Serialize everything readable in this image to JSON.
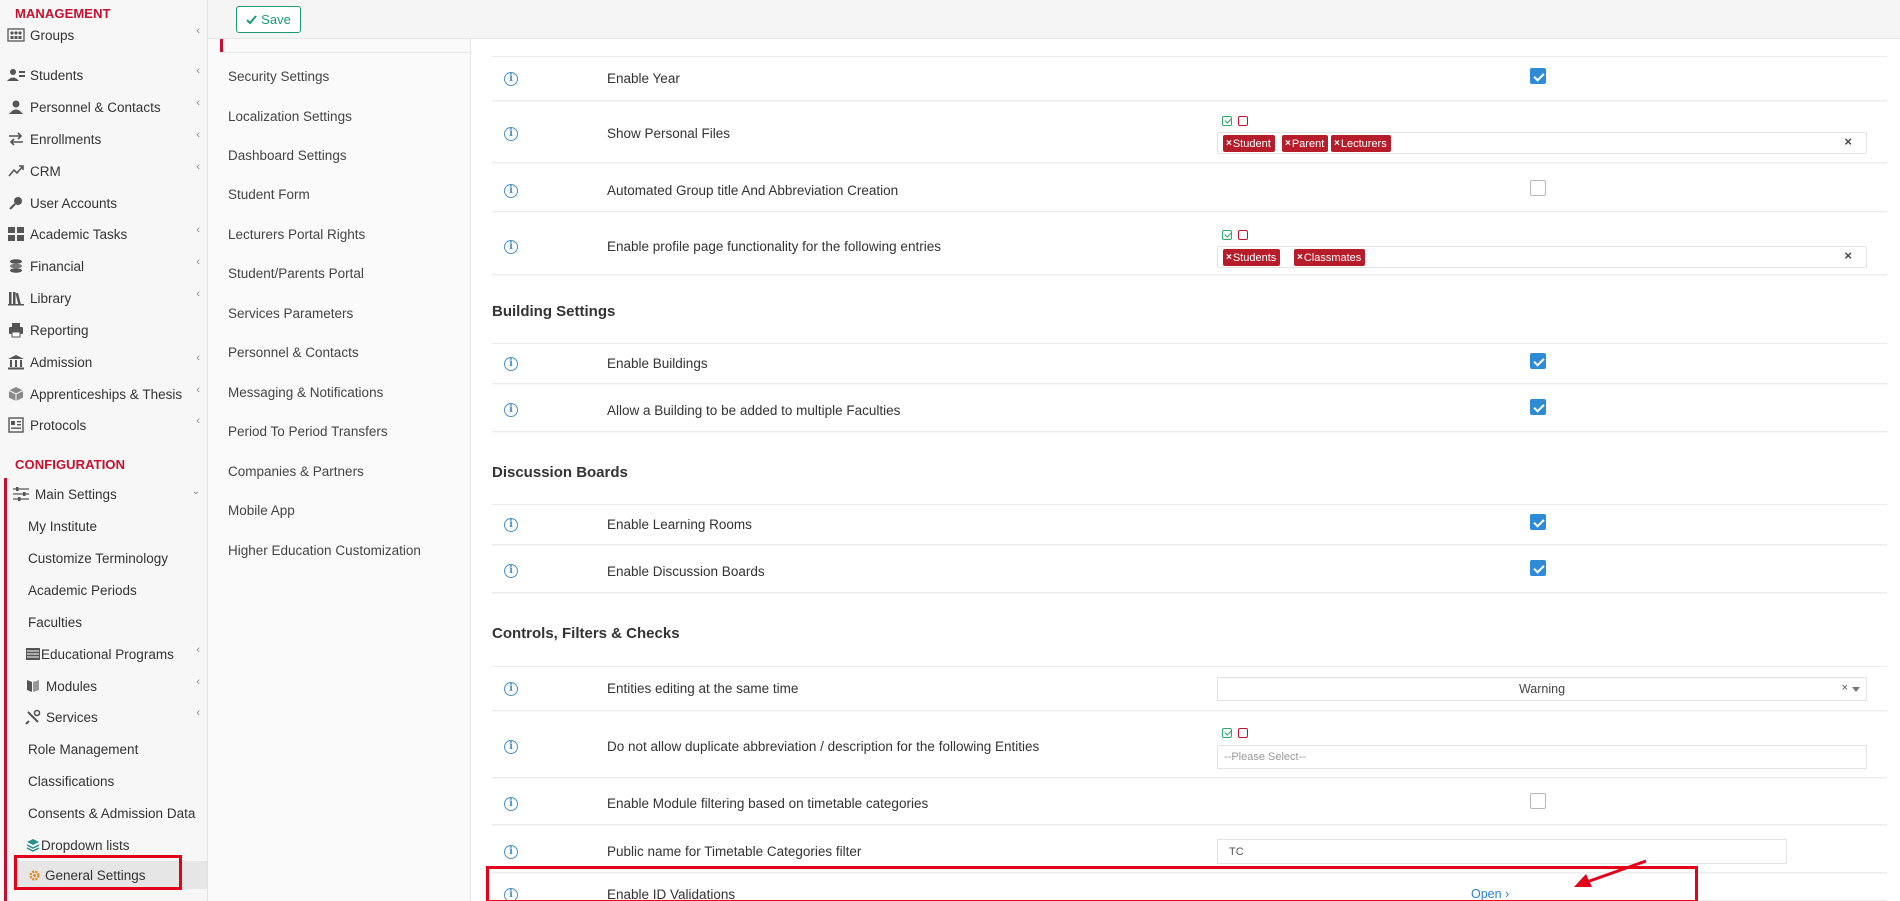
{
  "sidebar": {
    "management_title": "MANAGEMENT",
    "configuration_title": "CONFIGURATION",
    "management_items": [
      {
        "label": "Groups",
        "icon": "groups-icon",
        "has_submenu": true
      },
      {
        "label": "Students",
        "icon": "students-icon",
        "has_submenu": true
      },
      {
        "label": "Personnel & Contacts",
        "icon": "personnel-icon",
        "has_submenu": true
      },
      {
        "label": "Enrollments",
        "icon": "enrollments-icon",
        "has_submenu": true
      },
      {
        "label": "CRM",
        "icon": "crm-icon",
        "has_submenu": true
      },
      {
        "label": "User Accounts",
        "icon": "key-icon",
        "has_submenu": false
      },
      {
        "label": "Academic Tasks",
        "icon": "grid-icon",
        "has_submenu": true
      },
      {
        "label": "Financial",
        "icon": "coins-icon",
        "has_submenu": true
      },
      {
        "label": "Library",
        "icon": "library-icon",
        "has_submenu": true
      },
      {
        "label": "Reporting",
        "icon": "print-icon",
        "has_submenu": false
      },
      {
        "label": "Admission",
        "icon": "institution-icon",
        "has_submenu": true
      },
      {
        "label": "Apprenticeships & Thesis",
        "icon": "cube-icon",
        "has_submenu": true
      },
      {
        "label": "Protocols",
        "icon": "protocols-icon",
        "has_submenu": true
      }
    ],
    "main_settings": {
      "label": "Main Settings",
      "icon": "sliders-icon"
    },
    "config_items": [
      {
        "label": "My Institute"
      },
      {
        "label": "Customize Terminology"
      },
      {
        "label": "Academic Periods"
      },
      {
        "label": "Faculties"
      },
      {
        "label": "Educational Programs",
        "icon": "programs-icon",
        "has_submenu": true
      },
      {
        "label": "Modules",
        "icon": "book-icon",
        "has_submenu": true
      },
      {
        "label": "Services",
        "icon": "tools-icon",
        "has_submenu": true
      },
      {
        "label": "Role Management"
      },
      {
        "label": "Classifications"
      },
      {
        "label": "Consents & Admission Data"
      },
      {
        "label": "Dropdown lists",
        "icon": "layers-icon"
      },
      {
        "label": "General Settings",
        "icon": "gear-icon"
      }
    ]
  },
  "toolbar": {
    "save_label": "Save"
  },
  "settings_menu": [
    "Security Settings",
    "Localization Settings",
    "Dashboard Settings",
    "Student Form",
    "Lecturers Portal Rights",
    "Student/Parents Portal",
    "Services Parameters",
    "Personnel & Contacts",
    "Messaging & Notifications",
    "Period To Period Transfers",
    "Companies & Partners",
    "Mobile App",
    "Higher Education Customization"
  ],
  "sections": {
    "building": "Building Settings",
    "discussion": "Discussion Boards",
    "controls": "Controls, Filters & Checks"
  },
  "rows": {
    "enable_year": {
      "label": "Enable Year",
      "checked": true
    },
    "show_personal_files": {
      "label": "Show Personal Files",
      "tags": [
        "Student",
        "Parent",
        "Lecturers"
      ]
    },
    "automated_group_title": {
      "label": "Automated Group title And Abbreviation Creation",
      "checked": false
    },
    "enable_profile_page": {
      "label": "Enable profile page functionality for the following entries",
      "tags": [
        "Students",
        "Classmates"
      ]
    },
    "enable_buildings": {
      "label": "Enable Buildings",
      "checked": true
    },
    "building_multiple_faculties": {
      "label": "Allow a Building to be added to multiple Faculties",
      "checked": true
    },
    "enable_learning_rooms": {
      "label": "Enable Learning Rooms",
      "checked": true
    },
    "enable_discussion_boards": {
      "label": "Enable Discussion Boards",
      "checked": true
    },
    "entities_editing": {
      "label": "Entities editing at the same time",
      "value": "Warning"
    },
    "duplicate_abbreviation": {
      "label": "Do not allow duplicate abbreviation / description for the following Entities",
      "placeholder": "--Please Select--"
    },
    "module_filtering": {
      "label": "Enable Module filtering based on timetable categories",
      "checked": false
    },
    "public_name_filter": {
      "label": "Public name for Timetable Categories filter",
      "value": "TC"
    },
    "enable_id_validations": {
      "label": "Enable ID Validations",
      "link": "Open"
    }
  },
  "colors": {
    "accent_red": "#c8102e",
    "save_green": "#1e9b74",
    "checkbox_blue": "#2f8bd6",
    "tag_red": "#b71c2b",
    "link_blue": "#2a7fd0",
    "highlight_red": "#e3001b"
  }
}
